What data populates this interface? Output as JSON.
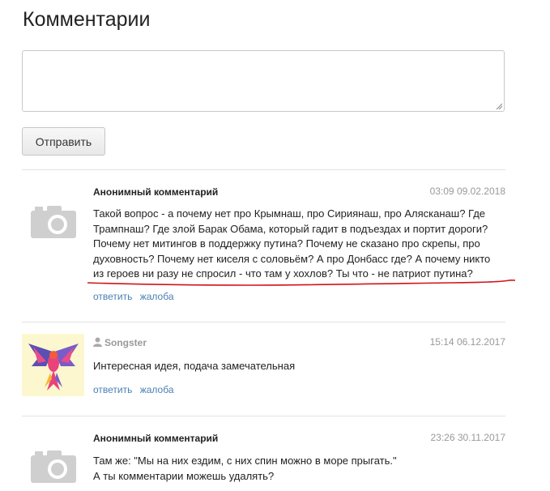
{
  "heading": "Комментарии",
  "textarea": {
    "value": ""
  },
  "send_label": "Отправить",
  "actions": {
    "reply": "ответить",
    "report": "жалоба"
  },
  "comments": [
    {
      "author": "Анонимный комментарий",
      "time": "03:09 09.02.2018",
      "avatar": "camera-icon",
      "lines": [
        "Такой вопрос - а почему нет про Крымнаш, про Сириянаш, про Алясканаш? Где",
        "Трампнаш? Где злой Барак Обама, который гадит в подъездах и портит дороги?",
        "Почему нет митингов в поддержку путина? Почему не сказано про скрепы, про",
        "духовность? Почему нет киселя с соловьём? А про Донбасс где? А почему никто",
        "из героев ни разу не спросил - что там у хохлов? Ты что - не патриот путина?"
      ]
    },
    {
      "author": "Songster",
      "time": "15:14 06.12.2017",
      "avatar": "parrot-avatar",
      "user_icon": "user-icon",
      "lines": [
        "Интересная идея, подача замечательная"
      ]
    },
    {
      "author": "Анонимный комментарий",
      "time": "23:26 30.11.2017",
      "avatar": "camera-icon",
      "lines": [
        "Там же: \"Мы на них ездим, с них спин можно в море прыгать.\"",
        "А ты комментарии можешь удалять?"
      ]
    }
  ],
  "colors": {
    "link": "#4a7fb5",
    "annotation": "#d0141b",
    "muted": "#999999"
  }
}
